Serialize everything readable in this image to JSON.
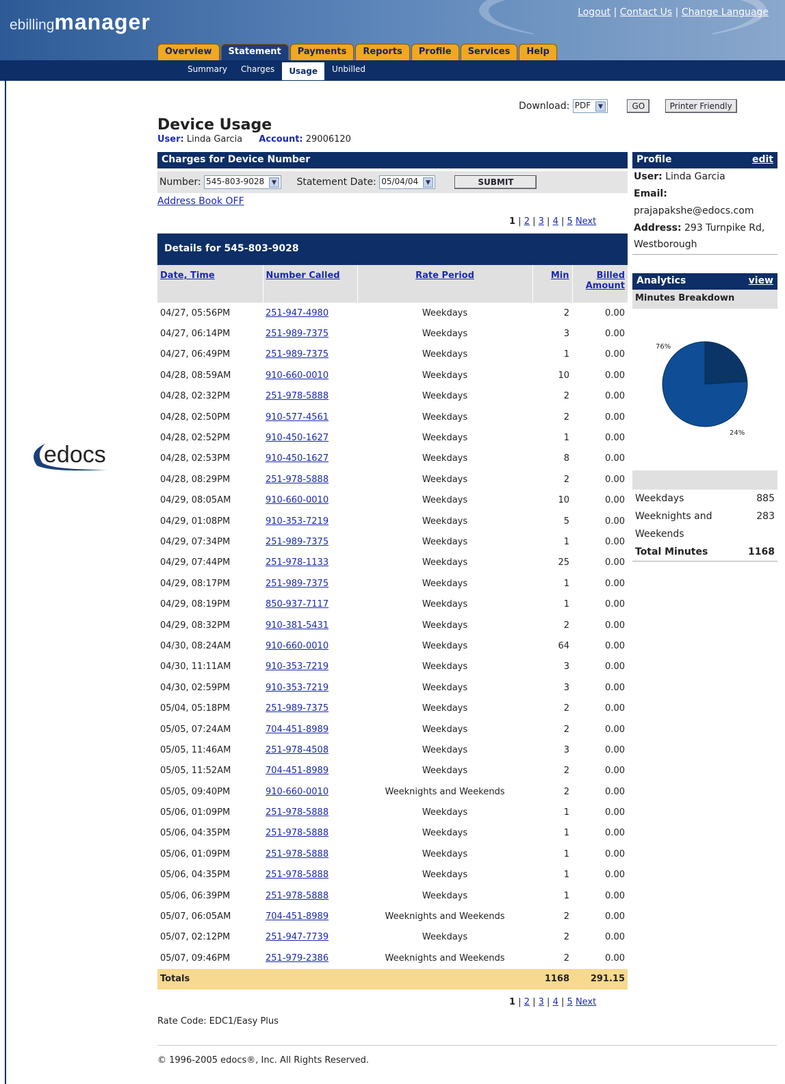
{
  "header": {
    "logo_small": "ebilling",
    "logo_big": "manager",
    "links": [
      "Logout",
      "Contact Us",
      "Change Language"
    ],
    "separator": "|"
  },
  "tabs": [
    "Overview",
    "Statement",
    "Payments",
    "Reports",
    "Profile",
    "Services",
    "Help"
  ],
  "active_tab": "Statement",
  "subtabs": [
    "Summary",
    "Charges",
    "Usage",
    "Unbilled"
  ],
  "active_subtab": "Usage",
  "download": {
    "label": "Download:",
    "format": "PDF",
    "go": "GO",
    "printer": "Printer Friendly"
  },
  "page": {
    "title": "Device Usage",
    "user_label": "User:",
    "user": "Linda Garcia",
    "account_label": "Account:",
    "account": "29006120"
  },
  "charges": {
    "bar_title": "Charges for Device Number",
    "number_label": "Number:",
    "number": "545-803-9028",
    "date_label": "Statement Date:",
    "date": "05/04/04",
    "submit": "SUBMIT",
    "address_book": "Address Book OFF"
  },
  "pager": {
    "current": "1",
    "pages": [
      "2",
      "3",
      "4",
      "5"
    ],
    "next": "Next"
  },
  "details_title": "Details for 545-803-9028",
  "columns": [
    "Date, Time",
    "Number Called",
    "Rate Period",
    "Min",
    "Billed Amount"
  ],
  "rows": [
    [
      "04/27, 05:56PM",
      "251-947-4980",
      "Weekdays",
      "2",
      "0.00"
    ],
    [
      "04/27, 06:14PM",
      "251-989-7375",
      "Weekdays",
      "3",
      "0.00"
    ],
    [
      "04/27, 06:49PM",
      "251-989-7375",
      "Weekdays",
      "1",
      "0.00"
    ],
    [
      "04/28, 08:59AM",
      "910-660-0010",
      "Weekdays",
      "10",
      "0.00"
    ],
    [
      "04/28, 02:32PM",
      "251-978-5888",
      "Weekdays",
      "2",
      "0.00"
    ],
    [
      "04/28, 02:50PM",
      "910-577-4561",
      "Weekdays",
      "2",
      "0.00"
    ],
    [
      "04/28, 02:52PM",
      "910-450-1627",
      "Weekdays",
      "1",
      "0.00"
    ],
    [
      "04/28, 02:53PM",
      "910-450-1627",
      "Weekdays",
      "8",
      "0.00"
    ],
    [
      "04/28, 08:29PM",
      "251-978-5888",
      "Weekdays",
      "2",
      "0.00"
    ],
    [
      "04/29, 08:05AM",
      "910-660-0010",
      "Weekdays",
      "10",
      "0.00"
    ],
    [
      "04/29, 01:08PM",
      "910-353-7219",
      "Weekdays",
      "5",
      "0.00"
    ],
    [
      "04/29, 07:34PM",
      "251-989-7375",
      "Weekdays",
      "1",
      "0.00"
    ],
    [
      "04/29, 07:44PM",
      "251-978-1133",
      "Weekdays",
      "25",
      "0.00"
    ],
    [
      "04/29, 08:17PM",
      "251-989-7375",
      "Weekdays",
      "1",
      "0.00"
    ],
    [
      "04/29, 08:19PM",
      "850-937-7117",
      "Weekdays",
      "1",
      "0.00"
    ],
    [
      "04/29, 08:32PM",
      "910-381-5431",
      "Weekdays",
      "2",
      "0.00"
    ],
    [
      "04/30, 08:24AM",
      "910-660-0010",
      "Weekdays",
      "64",
      "0.00"
    ],
    [
      "04/30, 11:11AM",
      "910-353-7219",
      "Weekdays",
      "3",
      "0.00"
    ],
    [
      "04/30, 02:59PM",
      "910-353-7219",
      "Weekdays",
      "3",
      "0.00"
    ],
    [
      "05/04, 05:18PM",
      "251-989-7375",
      "Weekdays",
      "2",
      "0.00"
    ],
    [
      "05/05, 07:24AM",
      "704-451-8989",
      "Weekdays",
      "2",
      "0.00"
    ],
    [
      "05/05, 11:46AM",
      "251-978-4508",
      "Weekdays",
      "3",
      "0.00"
    ],
    [
      "05/05, 11:52AM",
      "704-451-8989",
      "Weekdays",
      "2",
      "0.00"
    ],
    [
      "05/05, 09:40PM",
      "910-660-0010",
      "Weeknights and Weekends",
      "2",
      "0.00"
    ],
    [
      "05/06, 01:09PM",
      "251-978-5888",
      "Weekdays",
      "1",
      "0.00"
    ],
    [
      "05/06, 04:35PM",
      "251-978-5888",
      "Weekdays",
      "1",
      "0.00"
    ],
    [
      "05/06, 01:09PM",
      "251-978-5888",
      "Weekdays",
      "1",
      "0.00"
    ],
    [
      "05/06, 04:35PM",
      "251-978-5888",
      "Weekdays",
      "1",
      "0.00"
    ],
    [
      "05/06, 06:39PM",
      "251-978-5888",
      "Weekdays",
      "1",
      "0.00"
    ],
    [
      "05/07, 06:05AM",
      "704-451-8989",
      "Weeknights and Weekends",
      "2",
      "0.00"
    ],
    [
      "05/07, 02:12PM",
      "251-947-7739",
      "Weekdays",
      "2",
      "0.00"
    ],
    [
      "05/07, 09:46PM",
      "251-979-2386",
      "Weeknights and Weekends",
      "2",
      "0.00"
    ]
  ],
  "totals": {
    "label": "Totals",
    "min": "1168",
    "amount": "291.15"
  },
  "rate_code": "Rate Code: EDC1/Easy Plus",
  "footer": "© 1996-2005 edocs®, Inc. All Rights Reserved.",
  "edocs_logo": "edocs",
  "profile": {
    "title": "Profile",
    "edit": "edit",
    "user_label": "User:",
    "user": "Linda Garcia",
    "email_label": "Email:",
    "email": "prajapakshe@edocs.com",
    "address_label": "Address:",
    "address": "293 Turnpike Rd, Westborough"
  },
  "analytics": {
    "title": "Analytics",
    "view": "view",
    "subtitle": "Minutes Breakdown",
    "weekdays_label": "Weekdays",
    "weekdays": "885",
    "weeknights_label": "Weeknights and Weekends",
    "weeknights": "283",
    "total_label": "Total Minutes",
    "total": "1168"
  },
  "chart_data": {
    "type": "pie",
    "categories": [
      "Weekdays",
      "Weeknights and Weekends"
    ],
    "values": [
      76,
      24
    ],
    "labels": [
      "76%",
      "24%"
    ],
    "colors": [
      "#0f4e96",
      "#0a3566"
    ]
  }
}
